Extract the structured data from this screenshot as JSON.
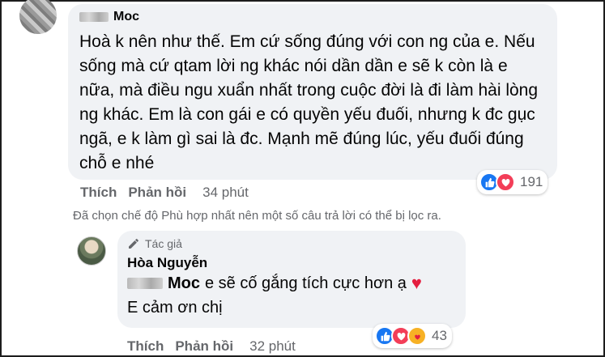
{
  "comment": {
    "author_name": "Moc",
    "text": "Hoà k nên như thế. Em cứ sống đúng với con ng của e. Nếu sống mà cứ qtam lời ng khác nói dần dần e sẽ k còn là e nữa, mà điều ngu xuẩn nhất trong cuộc đời là đi làm hài lòng ng khác. Em là con gái e có quyền yếu đuối, nhưng k đc gục ngã, e k làm gì sai là đc. Mạnh mẽ đúng lúc, yếu đuối đúng chỗ e nhé",
    "reaction_count": "191",
    "reactions": [
      "like-icon",
      "love-icon"
    ],
    "actions": {
      "like": "Thích",
      "reply": "Phản hồi",
      "time": "34 phút"
    }
  },
  "filter_note": "Đã chọn chế độ Phù hợp nhất nên một số câu trả lời có thể bị lọc ra.",
  "reply": {
    "author_badge": "Tác giả",
    "author_name": "Hòa Nguyễn",
    "mention": "Moc",
    "line1": "e sẽ cố gắng tích cực hơn ạ",
    "line2": "E cảm ơn chị",
    "reaction_count": "43",
    "reactions": [
      "like-icon",
      "love-icon",
      "care-icon"
    ],
    "actions": {
      "like": "Thích",
      "reply": "Phản hồi",
      "time": "32 phút"
    }
  },
  "colors": {
    "bubble": "#f0f2f5",
    "meta": "#65676b",
    "like": "#1877f2",
    "love": "#f33e58",
    "care": "#f7b125"
  }
}
